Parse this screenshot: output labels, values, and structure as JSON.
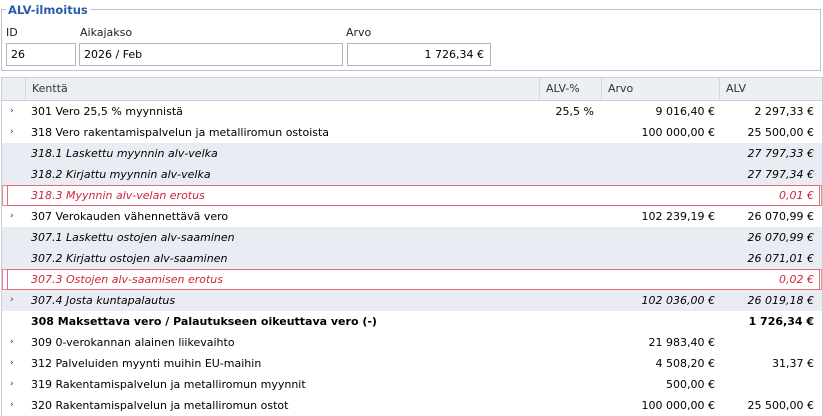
{
  "header": {
    "legend": "ALV-ilmoitus",
    "id_label": "ID",
    "id_value": "26",
    "period_label": "Aikajakso",
    "period_value": "2026 / Feb",
    "value_label": "Arvo",
    "value_value": "1 726,34 €"
  },
  "grid": {
    "columns": [
      "Kenttä",
      "ALV-%",
      "Arvo",
      "ALV"
    ],
    "expand_glyph": "›",
    "rows": [
      {
        "name": "301 Vero 25,5 % myynnistä",
        "pct": "25,5 %",
        "arvo": "9 016,40 €",
        "alv": "2 297,33 €",
        "expand": true
      },
      {
        "name": "318 Vero rakentamispalvelun ja metalliromun ostoista",
        "pct": "",
        "arvo": "100 000,00 €",
        "alv": "25 500,00 €",
        "expand": true
      },
      {
        "name": "318.1 Laskettu myynnin alv-velka",
        "pct": "",
        "arvo": "",
        "alv": "27 797,33 €",
        "expand": false
      },
      {
        "name": "318.2 Kirjattu myynnin alv-velka",
        "pct": "",
        "arvo": "",
        "alv": "27 797,34 €",
        "expand": false
      },
      {
        "name": "318.3 Myynnin alv-velan erotus",
        "pct": "",
        "arvo": "",
        "alv": "0,01 €",
        "expand": false
      },
      {
        "name": "307 Verokauden vähennettävä vero",
        "pct": "",
        "arvo": "102 239,19 €",
        "alv": "26 070,99 €",
        "expand": true
      },
      {
        "name": "307.1 Laskettu ostojen alv-saaminen",
        "pct": "",
        "arvo": "",
        "alv": "26 070,99 €",
        "expand": false
      },
      {
        "name": "307.2 Kirjattu ostojen alv-saaminen",
        "pct": "",
        "arvo": "",
        "alv": "26 071,01 €",
        "expand": false
      },
      {
        "name": "307.3 Ostojen alv-saamisen erotus",
        "pct": "",
        "arvo": "",
        "alv": "0,02 €",
        "expand": false
      },
      {
        "name": "307.4 Josta kuntapalautus",
        "pct": "",
        "arvo": "102 036,00 €",
        "alv": "26 019,18 €",
        "expand": true
      },
      {
        "name": "308 Maksettava vero / Palautukseen oikeuttava vero (-)",
        "pct": "",
        "arvo": "",
        "alv": "1 726,34 €",
        "expand": false
      },
      {
        "name": "309 0-verokannan alainen liikevaihto",
        "pct": "",
        "arvo": "21 983,40 €",
        "alv": "",
        "expand": true
      },
      {
        "name": "312 Palveluiden myynti muihin EU-maihin",
        "pct": "",
        "arvo": "4 508,20 €",
        "alv": "31,37 €",
        "expand": true
      },
      {
        "name": "319 Rakentamispalvelun ja metalliromun myynnit",
        "pct": "",
        "arvo": "500,00 €",
        "alv": "",
        "expand": true
      },
      {
        "name": "320 Rakentamispalvelun ja metalliromun ostot",
        "pct": "",
        "arvo": "100 000,00 €",
        "alv": "25 500,00 €",
        "expand": true
      }
    ]
  }
}
